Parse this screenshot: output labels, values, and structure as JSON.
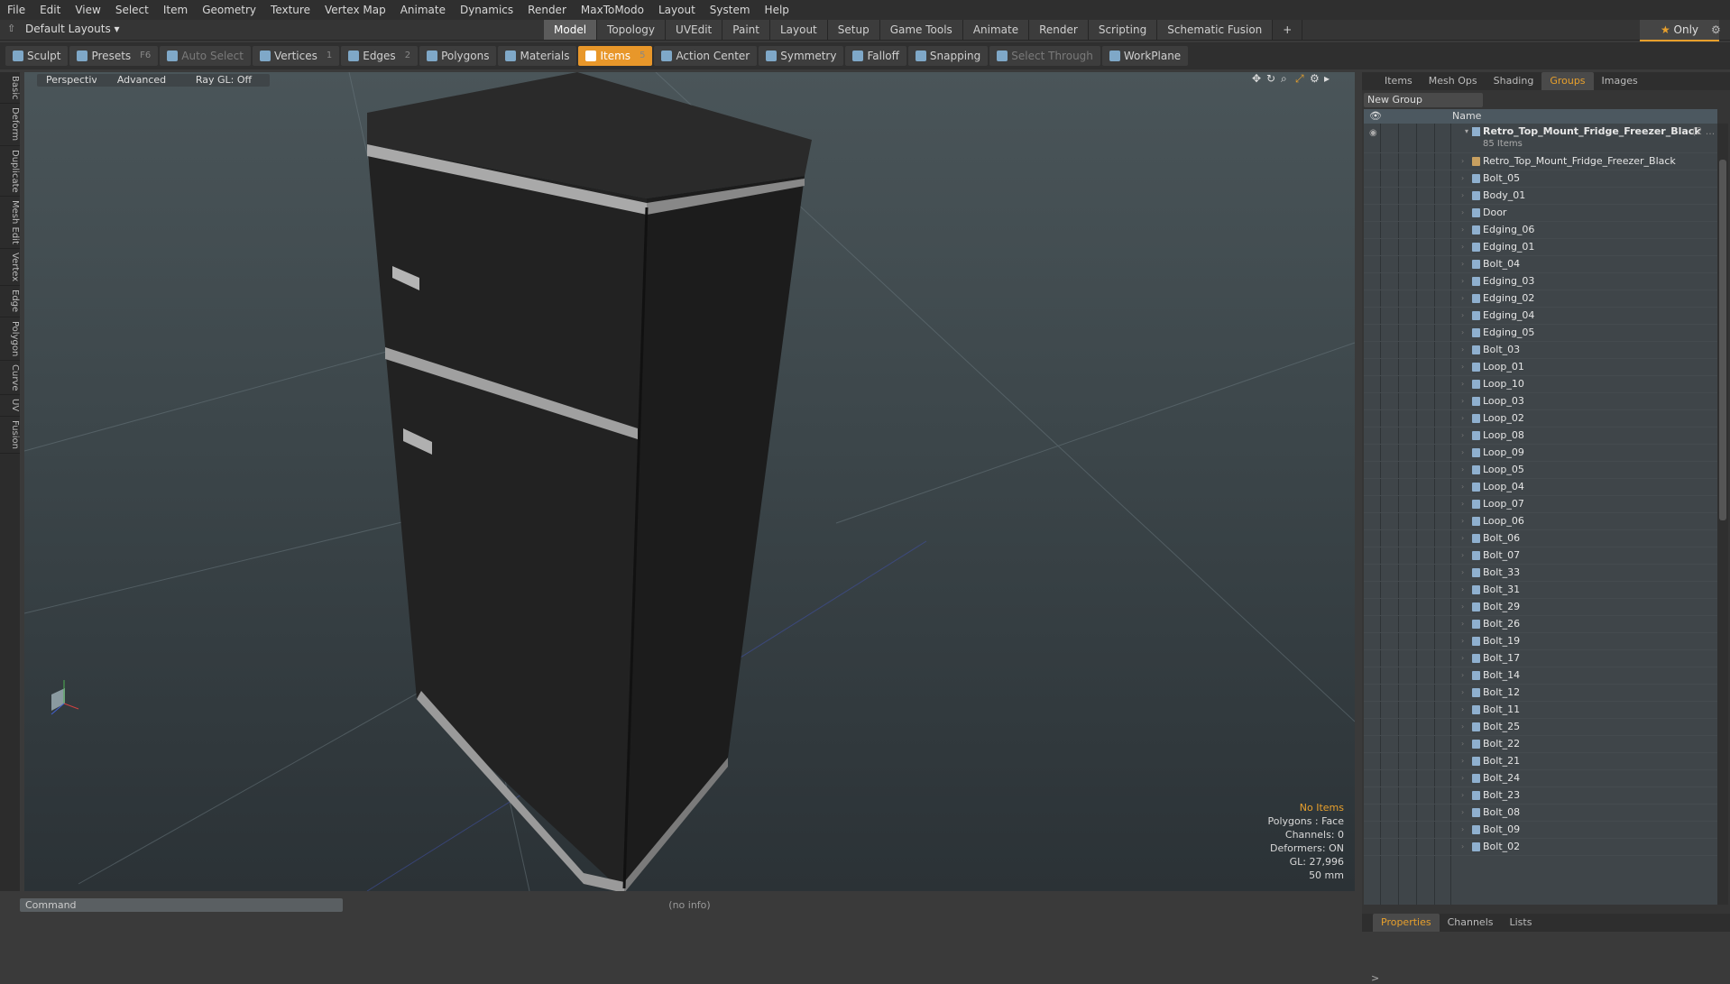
{
  "menu": [
    "File",
    "Edit",
    "View",
    "Select",
    "Item",
    "Geometry",
    "Texture",
    "Vertex Map",
    "Animate",
    "Dynamics",
    "Render",
    "MaxToModo",
    "Layout",
    "System",
    "Help"
  ],
  "layout": {
    "current": "Default Layouts"
  },
  "tabs": [
    {
      "label": "Model",
      "active": true
    },
    {
      "label": "Topology"
    },
    {
      "label": "UVEdit"
    },
    {
      "label": "Paint"
    },
    {
      "label": "Layout"
    },
    {
      "label": "Setup"
    },
    {
      "label": "Game Tools"
    },
    {
      "label": "Animate"
    },
    {
      "label": "Render"
    },
    {
      "label": "Scripting"
    },
    {
      "label": "Schematic Fusion"
    }
  ],
  "add_tab": "+",
  "only_label": "Only",
  "toolbar": [
    {
      "label": "Sculpt"
    },
    {
      "label": "Presets",
      "key": "F6"
    },
    {
      "label": "Auto Select",
      "disabled": true
    },
    {
      "label": "Vertices",
      "key": "1"
    },
    {
      "label": "Edges",
      "key": "2"
    },
    {
      "label": "Polygons"
    },
    {
      "label": "Materials"
    },
    {
      "label": "Items",
      "key": "5",
      "active": true
    },
    {
      "label": "Action Center"
    },
    {
      "label": "Symmetry"
    },
    {
      "label": "Falloff"
    },
    {
      "label": "Snapping"
    },
    {
      "label": "Select Through",
      "disabled": true
    },
    {
      "label": "WorkPlane"
    }
  ],
  "left_tabs": [
    "Basic",
    "Deform",
    "Duplicate",
    "Mesh Edit",
    "Vertex",
    "Edge",
    "Polygon",
    "Curve",
    "UV",
    "Fusion"
  ],
  "viewport": {
    "view": "Perspective",
    "shading": "Advanced",
    "raygl": "Ray GL: Off",
    "info": {
      "items": "No Items",
      "polygons": "Polygons : Face",
      "channels": "Channels: 0",
      "deformers": "Deformers: ON",
      "gl": "GL: 27,996",
      "scale": "50 mm"
    }
  },
  "status": "(no info)",
  "right_panel": {
    "tabs": [
      {
        "label": "Items"
      },
      {
        "label": "Mesh Ops"
      },
      {
        "label": "Shading"
      },
      {
        "label": "Groups",
        "active": true
      },
      {
        "label": "Images"
      }
    ],
    "new_group": "New Group",
    "column_name": "Name",
    "group": {
      "name": "Retro_Top_Mount_Fridge_Freezer_Black",
      "count_suffix": "(2 ...",
      "items_count": "85 Items"
    },
    "items": [
      "Retro_Top_Mount_Fridge_Freezer_Black",
      "Bolt_05",
      "Body_01",
      "Door",
      "Edging_06",
      "Edging_01",
      "Bolt_04",
      "Edging_03",
      "Edging_02",
      "Edging_04",
      "Edging_05",
      "Bolt_03",
      "Loop_01",
      "Loop_10",
      "Loop_03",
      "Loop_02",
      "Loop_08",
      "Loop_09",
      "Loop_05",
      "Loop_04",
      "Loop_07",
      "Loop_06",
      "Bolt_06",
      "Bolt_07",
      "Bolt_33",
      "Bolt_31",
      "Bolt_29",
      "Bolt_26",
      "Bolt_19",
      "Bolt_17",
      "Bolt_14",
      "Bolt_12",
      "Bolt_11",
      "Bolt_25",
      "Bolt_22",
      "Bolt_21",
      "Bolt_24",
      "Bolt_23",
      "Bolt_08",
      "Bolt_09",
      "Bolt_02"
    ],
    "bottom_tabs": [
      {
        "label": "Properties",
        "active": true
      },
      {
        "label": "Channels"
      },
      {
        "label": "Lists"
      }
    ],
    "command_placeholder": "Command"
  }
}
